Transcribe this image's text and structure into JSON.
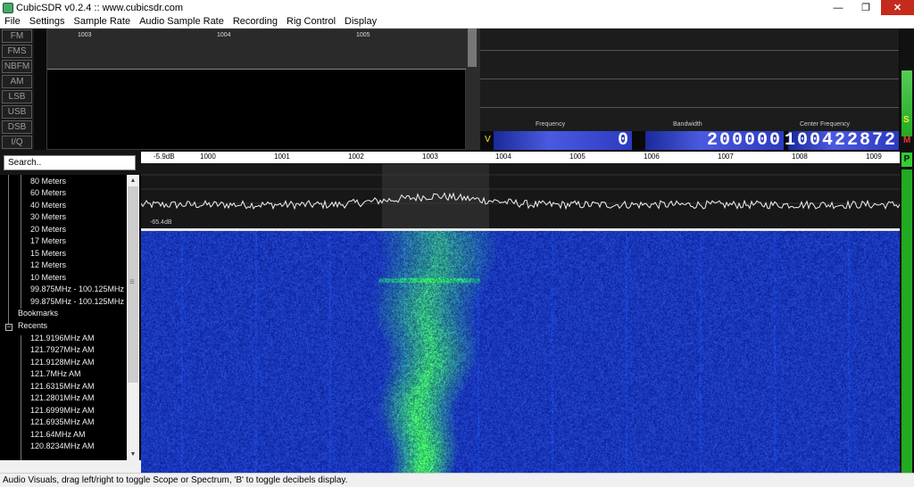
{
  "window": {
    "title": "CubicSDR v0.2.4 :: www.cubicsdr.com",
    "min": "—",
    "max": "❐",
    "close": "✕"
  },
  "menu": [
    "File",
    "Settings",
    "Sample Rate",
    "Audio Sample Rate",
    "Recording",
    "Rig Control",
    "Display"
  ],
  "modes": [
    "FM",
    "FMS",
    "NBFM",
    "AM",
    "LSB",
    "USB",
    "DSB",
    "I/Q"
  ],
  "audio_scope_ticks": [
    "1003",
    "1004",
    "1005"
  ],
  "digits": {
    "frequency_label": "Frequency",
    "bandwidth_label": "Bandwidth",
    "center_label": "Center Frequency",
    "frequency": "0",
    "bandwidth": "200000",
    "center": "100422872"
  },
  "meter_labels": {
    "s": "S",
    "m": "M",
    "v": "V",
    "p": "P"
  },
  "search": {
    "placeholder": "Search..",
    "value": "Search.."
  },
  "tree": {
    "bands": [
      "80 Meters",
      "60 Meters",
      "40 Meters",
      "30 Meters",
      "20 Meters",
      "17 Meters",
      "15 Meters",
      "12 Meters",
      "10 Meters",
      "99.875MHz - 100.125MHz",
      "99.875MHz - 100.125MHz"
    ],
    "bookmarks": "Bookmarks",
    "recents_label": "Recents",
    "recents_expander": "−",
    "recents": [
      "121.9196MHz AM",
      "121.7927MHz AM",
      "121.9128MHz AM",
      "121.7MHz AM",
      "121.6315MHz AM",
      "121.2801MHz AM",
      "121.6999MHz AM",
      "121.6935MHz AM",
      "121.64MHz AM",
      "120.8234MHz AM"
    ],
    "grip": "≡",
    "scroll_up": "▲",
    "scroll_down": "▼"
  },
  "spectrum": {
    "db_top": "-5.9dB",
    "db_bottom": "-65.4dB",
    "ticks": [
      "1000",
      "1001",
      "1002",
      "1003",
      "1004",
      "1005",
      "1006",
      "1007",
      "1008",
      "1009"
    ]
  },
  "status": "Audio Visuals, drag left/right to toggle Scope or Spectrum, 'B' to toggle decibels display."
}
